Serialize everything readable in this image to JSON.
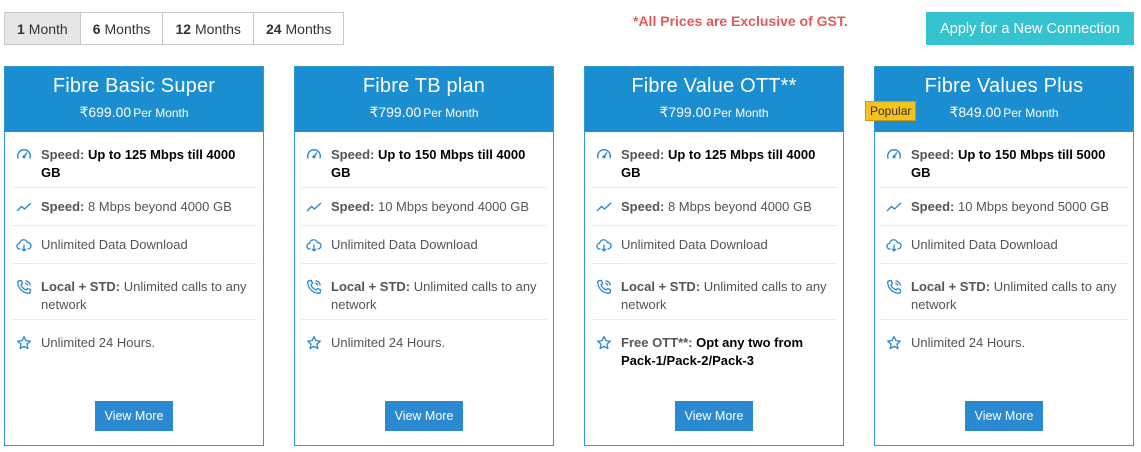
{
  "tabs": [
    {
      "num": "1",
      "unit": "Month"
    },
    {
      "num": "6",
      "unit": "Months"
    },
    {
      "num": "12",
      "unit": "Months"
    },
    {
      "num": "24",
      "unit": "Months"
    }
  ],
  "gst_note": "*All Prices are Exclusive of GST.",
  "apply_label": "Apply for a New Connection",
  "per_month_label": "Per Month",
  "view_more_label": "View More",
  "popular_label": "Popular",
  "colors": {
    "header": "#1a8ed1",
    "apply": "#35c3d0",
    "gst": "#e05a5a",
    "popular": "#f6c21c",
    "icon": "#2b89d1"
  },
  "plans": [
    {
      "name": "Fibre Basic Super",
      "price": "₹699.00",
      "popular": false,
      "features": [
        {
          "icon": "speedometer-icon",
          "label": "Speed:",
          "text": "Up to 125 Mbps till 4000 GB",
          "text_bold": true
        },
        {
          "icon": "trend-line-icon",
          "label": "Speed:",
          "text": "8 Mbps beyond 4000 GB",
          "text_bold": false
        },
        {
          "icon": "cloud-download-icon",
          "label": "",
          "text": "Unlimited Data Download",
          "text_bold": false
        },
        {
          "icon": "phone-call-icon",
          "label": "Local + STD:",
          "text": "Unlimited calls to any network",
          "text_bold": false
        },
        {
          "icon": "star-icon",
          "label": "",
          "text": "Unlimited 24 Hours.",
          "text_bold": false
        }
      ]
    },
    {
      "name": "Fibre TB plan",
      "price": "₹799.00",
      "popular": false,
      "features": [
        {
          "icon": "speedometer-icon",
          "label": "Speed:",
          "text": "Up to 150 Mbps till 4000 GB",
          "text_bold": true
        },
        {
          "icon": "trend-line-icon",
          "label": "Speed:",
          "text": "10 Mbps beyond 4000 GB",
          "text_bold": false
        },
        {
          "icon": "cloud-download-icon",
          "label": "",
          "text": "Unlimited Data Download",
          "text_bold": false
        },
        {
          "icon": "phone-call-icon",
          "label": "Local + STD:",
          "text": "Unlimited calls to any network",
          "text_bold": false
        },
        {
          "icon": "star-icon",
          "label": "",
          "text": "Unlimited 24 Hours.",
          "text_bold": false
        }
      ]
    },
    {
      "name": "Fibre Value OTT**",
      "price": "₹799.00",
      "popular": false,
      "features": [
        {
          "icon": "speedometer-icon",
          "label": "Speed:",
          "text": "Up to 125 Mbps till 4000 GB",
          "text_bold": true
        },
        {
          "icon": "trend-line-icon",
          "label": "Speed:",
          "text": "8 Mbps beyond 4000 GB",
          "text_bold": false
        },
        {
          "icon": "cloud-download-icon",
          "label": "",
          "text": "Unlimited Data Download",
          "text_bold": false
        },
        {
          "icon": "phone-call-icon",
          "label": "Local + STD:",
          "text": "Unlimited calls to any network",
          "text_bold": false
        },
        {
          "icon": "star-icon",
          "label": "Free OTT**:",
          "text": "Opt any two from Pack-1/Pack-2/Pack-3",
          "text_bold": true
        }
      ]
    },
    {
      "name": "Fibre Values Plus",
      "price": "₹849.00",
      "popular": true,
      "features": [
        {
          "icon": "speedometer-icon",
          "label": "Speed:",
          "text": "Up to 150 Mbps till 5000 GB",
          "text_bold": true
        },
        {
          "icon": "trend-line-icon",
          "label": "Speed:",
          "text": "10 Mbps beyond 5000 GB",
          "text_bold": false
        },
        {
          "icon": "cloud-download-icon",
          "label": "",
          "text": "Unlimited Data Download",
          "text_bold": false
        },
        {
          "icon": "phone-call-icon",
          "label": "Local + STD:",
          "text": "Unlimited calls to any network",
          "text_bold": false
        },
        {
          "icon": "star-icon",
          "label": "",
          "text": "Unlimited 24 Hours.",
          "text_bold": false
        }
      ]
    }
  ]
}
